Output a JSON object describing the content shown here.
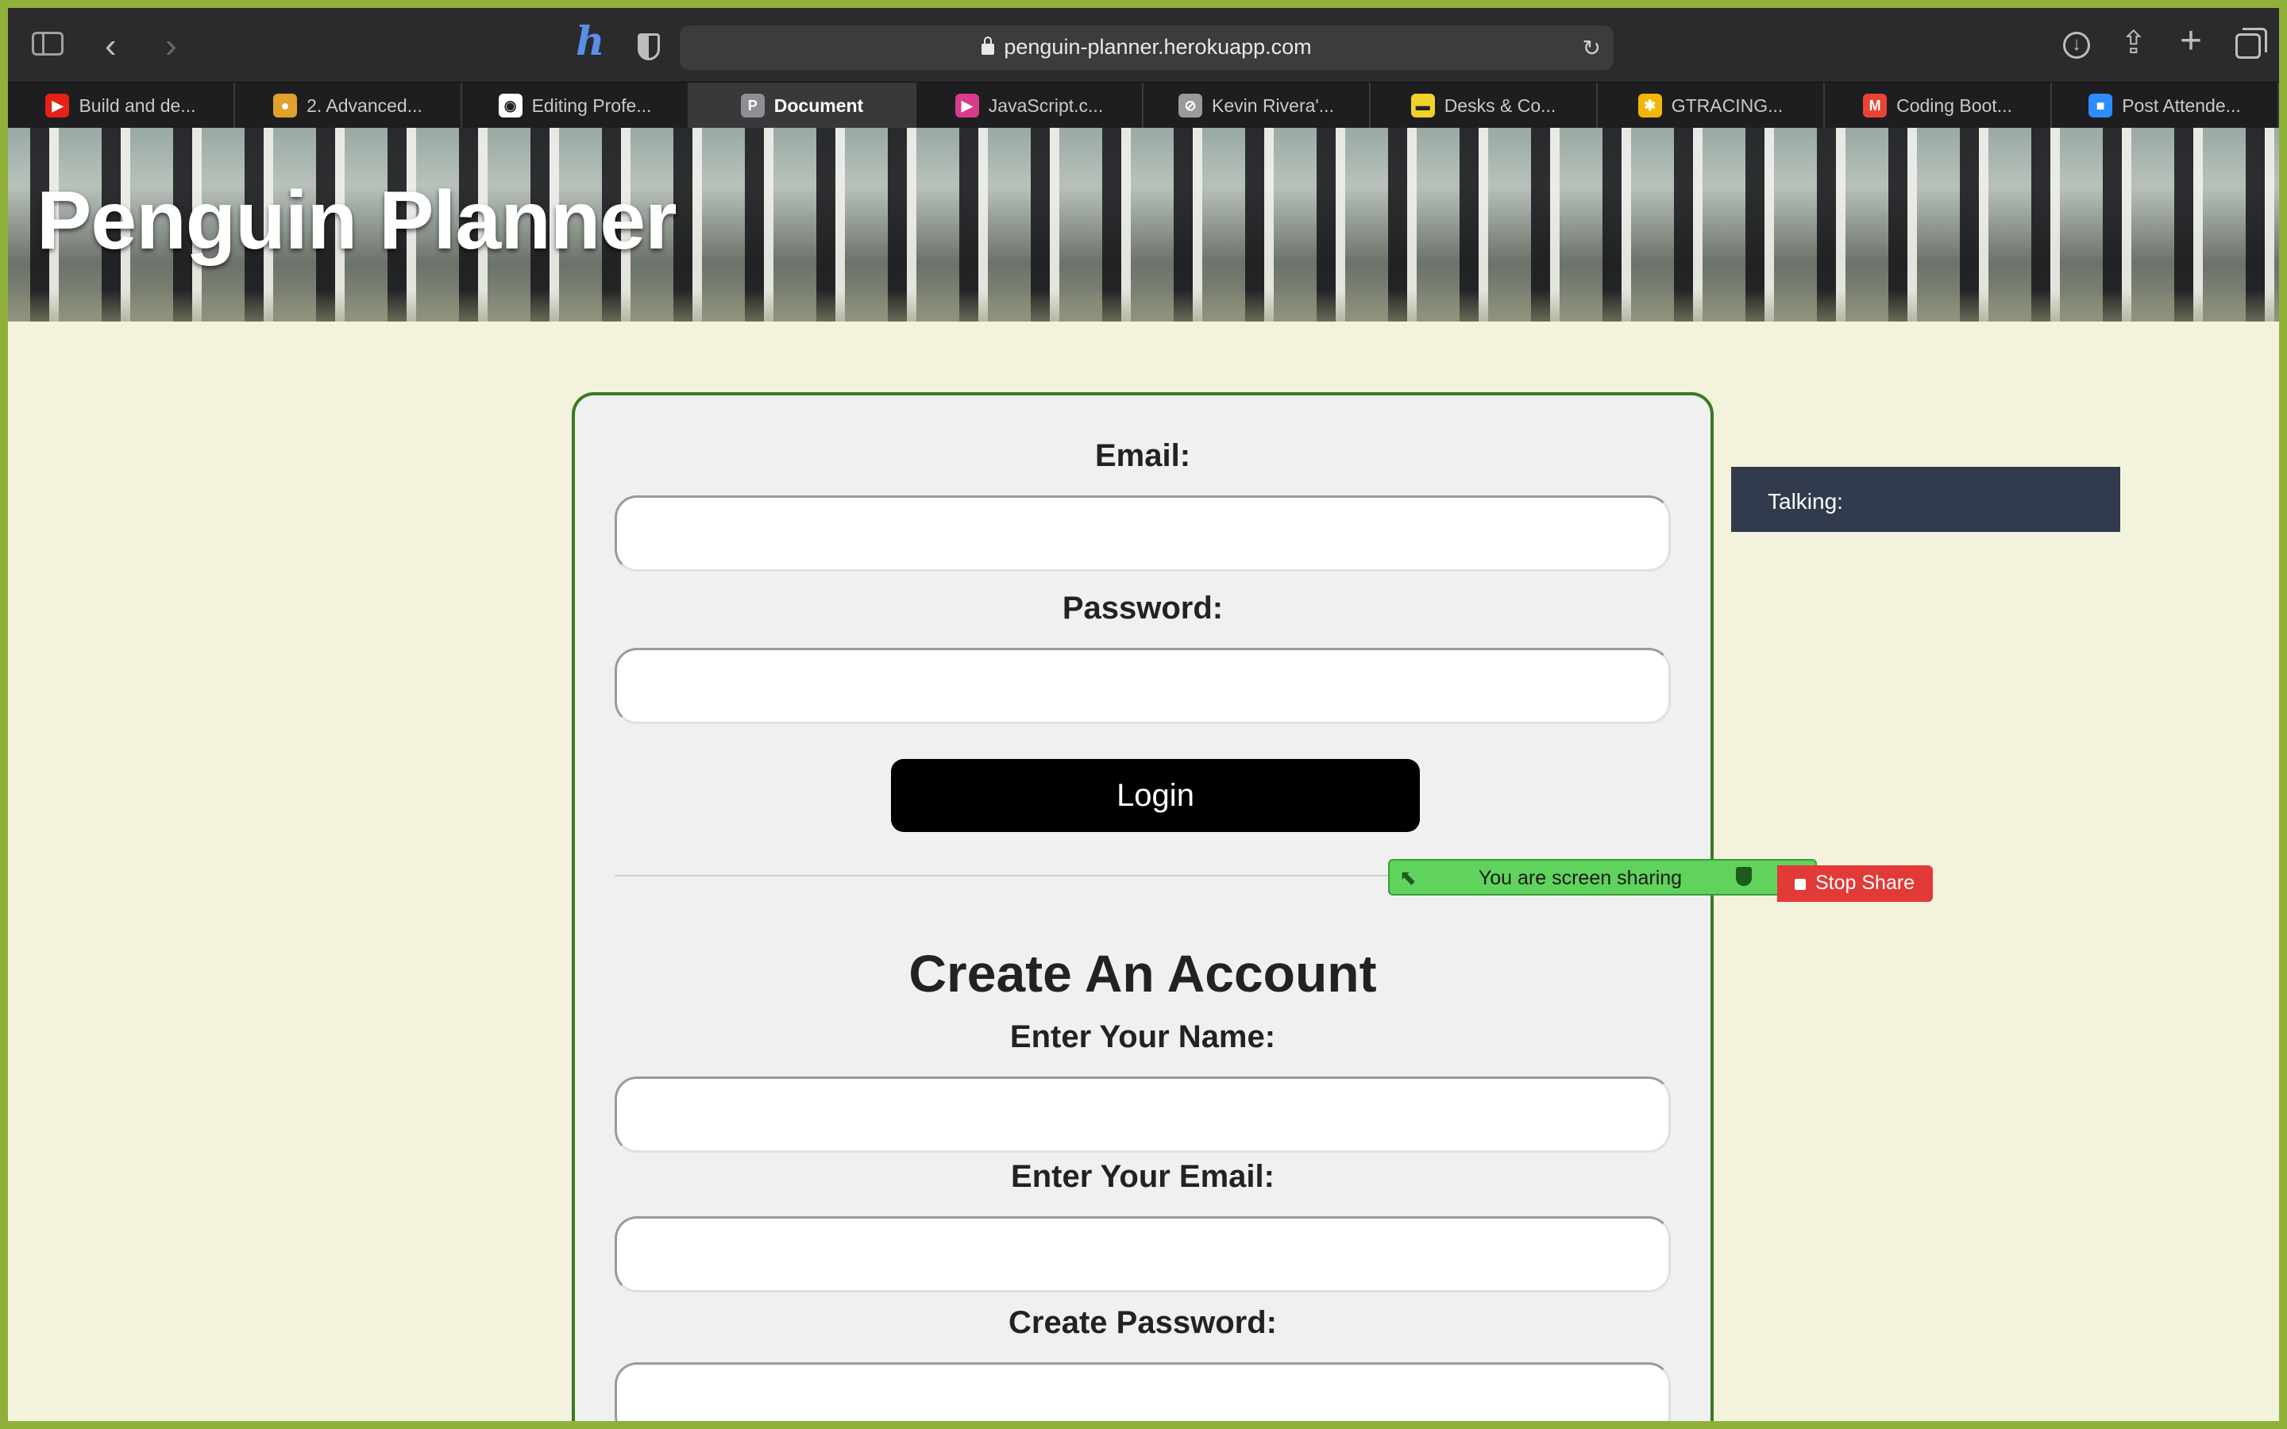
{
  "browser": {
    "url": "penguin-planner.herokuapp.com",
    "icons": [
      "sidebar-icon",
      "back-icon",
      "forward-icon",
      "honey-extension-icon",
      "privacy-shield-icon",
      "reload-icon",
      "download-icon",
      "share-icon",
      "new-tab-icon",
      "tab-overview-icon"
    ]
  },
  "tabs": [
    {
      "label": "Build and de...",
      "favicon": "youtube-icon",
      "color": "#e62117",
      "glyph": "▶"
    },
    {
      "label": "2. Advanced...",
      "favicon": "course-icon",
      "color": "#e0a22a",
      "glyph": "●"
    },
    {
      "label": "Editing Profe...",
      "favicon": "github-icon",
      "color": "#ffffff",
      "glyph": "◉"
    },
    {
      "label": "Document",
      "favicon": "document-icon",
      "color": "#8e8e93",
      "glyph": "P",
      "active": true
    },
    {
      "label": "JavaScript.c...",
      "favicon": "javascript-icon",
      "color": "#d93a8c",
      "glyph": "▶"
    },
    {
      "label": "Kevin Rivera'...",
      "favicon": "compass-icon",
      "color": "#9a9a9c",
      "glyph": "⊘"
    },
    {
      "label": "Desks & Co...",
      "favicon": "ikea-icon",
      "color": "#f2d12b",
      "glyph": "▬"
    },
    {
      "label": "GTRACING...",
      "favicon": "walmart-icon",
      "color": "#f2b705",
      "glyph": "✱"
    },
    {
      "label": "Coding Boot...",
      "favicon": "gmail-icon",
      "color": "#ea4335",
      "glyph": "M"
    },
    {
      "label": "Post Attende...",
      "favicon": "zoom-icon",
      "color": "#2d8cff",
      "glyph": "■"
    }
  ],
  "page": {
    "title": "Penguin Planner",
    "login": {
      "email_label": "Email:",
      "email_value": "",
      "password_label": "Password:",
      "password_value": "",
      "login_button": "Login"
    },
    "signup": {
      "heading": "Create An Account",
      "name_label": "Enter Your Name:",
      "email_label": "Enter Your Email:",
      "password_label": "Create Password:"
    }
  },
  "zoom": {
    "talking_label": "Talking:",
    "share_status": "You are screen sharing",
    "stop_share": "Stop Share"
  }
}
